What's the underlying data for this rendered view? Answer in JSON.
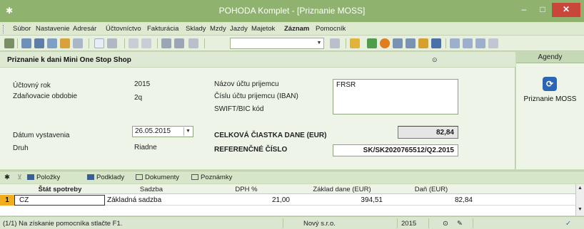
{
  "window": {
    "title": "POHODA Komplet - [Priznanie MOSS]",
    "minimize": "–",
    "maximize": "□",
    "close": "✕"
  },
  "menu": [
    "Súbor",
    "Nastavenie",
    "Adresár",
    "Účtovníctvo",
    "Fakturácia",
    "Sklady",
    "Mzdy",
    "Jazdy",
    "Majetok",
    "Záznam",
    "Pomocník"
  ],
  "toolbar": {
    "combo_value": ""
  },
  "form": {
    "title": "Priznanie k dani Mini One Stop Shop",
    "uctovny_rok_label": "Účtovný rok",
    "uctovny_rok_value": "2015",
    "obdobie_label": "Zdaňovacie obdobie",
    "obdobie_value": "2q",
    "nazov_uctu_label": "Názov účtu prijemcu",
    "iban_label": "Číslu účtu prijemcu (IBAN)",
    "swift_label": "SWIFT/BIC kód",
    "recipient_value": "FRSR",
    "datum_label": "Dátum vystavenia",
    "datum_value": "26.05.2015",
    "druh_label": "Druh",
    "druh_value": "Riadne",
    "celkova_label": "CELKOVÁ ČIASTKA DANE (EUR)",
    "celkova_value": "82,84",
    "ref_label": "REFERENČNÉ ČÍSLO",
    "ref_value": "SK/SK2020765512/Q2.2015"
  },
  "agendy": {
    "header": "Agendy",
    "item_label": "Priznanie MOSS"
  },
  "tabs": [
    {
      "label": "Položky"
    },
    {
      "label": "Podklady"
    },
    {
      "label": "Dokumenty"
    },
    {
      "label": "Poznámky"
    }
  ],
  "grid": {
    "headers": [
      "Štát spotreby",
      "Sadzba",
      "DPH %",
      "Základ dane (EUR)",
      "Daň (EUR)"
    ],
    "rows": [
      {
        "num": "1",
        "stat": "CZ",
        "sadzba": "Základná sadzba",
        "dph": "21,00",
        "zaklad": "394,51",
        "dan": "82,84"
      }
    ]
  },
  "status": {
    "hint": "(1/1) Na získanie pomocníka stlačte F1.",
    "company": "Nový s.r.o.",
    "year": "2015"
  }
}
